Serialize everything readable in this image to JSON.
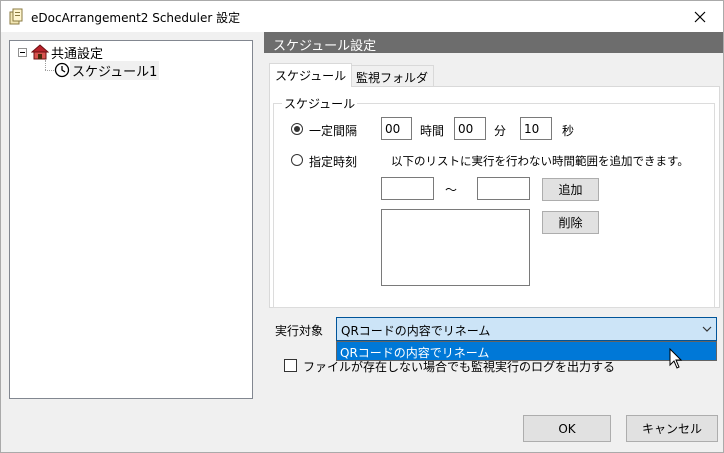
{
  "window": {
    "title": "eDocArrangement2 Scheduler 設定"
  },
  "tree": {
    "root_label": "共通設定",
    "child_label": "スケジュール1"
  },
  "panel": {
    "header": "スケジュール設定"
  },
  "tabs": [
    {
      "label": "スケジュール",
      "active": true
    },
    {
      "label": "監視フォルダ",
      "active": false
    }
  ],
  "schedule": {
    "group_title": "スケジュール",
    "interval": {
      "label": "一定間隔",
      "selected": true,
      "hours": "00",
      "hours_unit": "時間",
      "minutes": "00",
      "minutes_unit": "分",
      "seconds": "10",
      "seconds_unit": "秒"
    },
    "specified": {
      "label": "指定時刻",
      "selected": false,
      "hint": "以下のリストに実行を行わない時間範囲を追加できます。",
      "from": "",
      "tilde": "～",
      "to": "",
      "add_label": "追加",
      "delete_label": "削除"
    }
  },
  "target": {
    "label": "実行対象",
    "selected": "QRコードの内容でリネーム",
    "options": [
      "QRコードの内容でリネーム"
    ]
  },
  "log_option": {
    "label": "ファイルが存在しない場合でも監視実行のログを出力する",
    "checked": false
  },
  "buttons": {
    "ok": "OK",
    "cancel": "キャンセル"
  },
  "colors": {
    "header_bg": "#6d6d6d",
    "selection": "#0078d7",
    "combo_focus": "#cce4f7",
    "button_bg": "#e1e1e1"
  }
}
